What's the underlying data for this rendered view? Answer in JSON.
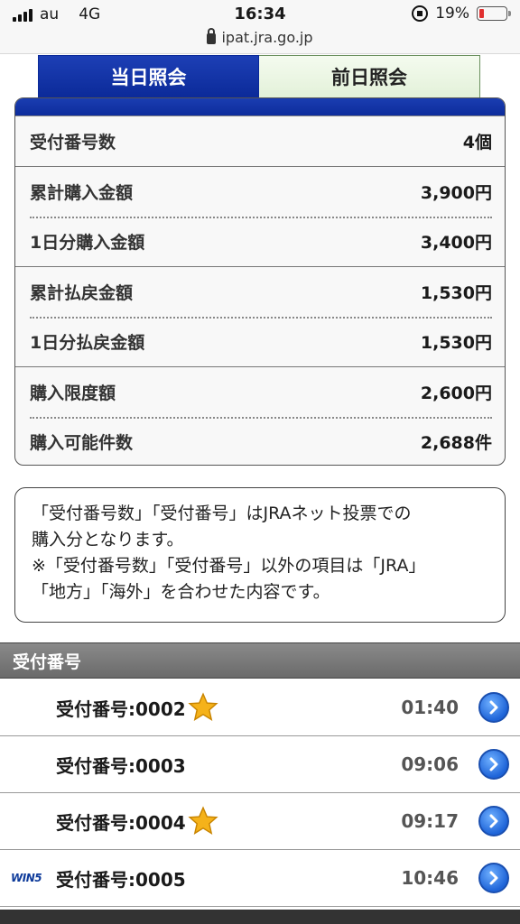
{
  "status_bar": {
    "carrier": "au",
    "network": "4G",
    "time": "16:34",
    "battery": "19%",
    "battery_color": "#e03030",
    "url": "ipat.jra.go.jp"
  },
  "tabs": [
    {
      "label": "当日照会",
      "active": true
    },
    {
      "label": "前日照会",
      "active": false
    }
  ],
  "summary": [
    {
      "label": "受付番号数",
      "value": "4個"
    },
    {
      "label": "累計購入金額",
      "value": "3,900円"
    },
    {
      "label": "1日分購入金額",
      "value": "3,400円"
    },
    {
      "label": "累計払戻金額",
      "value": "1,530円"
    },
    {
      "label": "1日分払戻金額",
      "value": "1,530円"
    },
    {
      "label": "購入限度額",
      "value": "2,600円"
    },
    {
      "label": "購入可能件数",
      "value": "2,688件"
    }
  ],
  "note": {
    "line1": "「受付番号数」「受付番号」はJRAネット投票での",
    "line2": "購入分となります。",
    "line3": "※「受付番号数」「受付番号」以外の項目は「JRA」",
    "line4": "「地方」「海外」を合わせた内容です。"
  },
  "section_title": "受付番号",
  "receipts": [
    {
      "label": "受付番号:0002",
      "time": "01:40",
      "starred": true,
      "badge": ""
    },
    {
      "label": "受付番号:0003",
      "time": "09:06",
      "starred": false,
      "badge": ""
    },
    {
      "label": "受付番号:0004",
      "time": "09:17",
      "starred": true,
      "badge": ""
    },
    {
      "label": "受付番号:0005",
      "time": "10:46",
      "starred": false,
      "badge": "WIN5"
    }
  ],
  "icons": {
    "star": "star-icon",
    "arrow": "chevron-right-circle-icon",
    "lock": "lock-icon"
  }
}
